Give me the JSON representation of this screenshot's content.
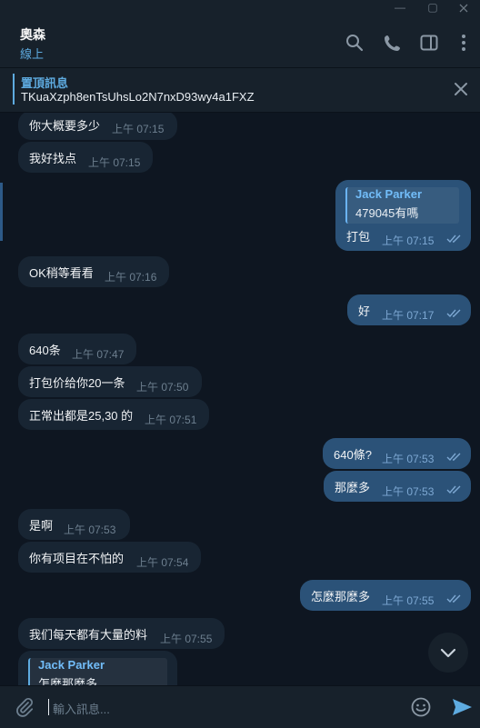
{
  "header": {
    "name": "奧森",
    "status": "線上"
  },
  "window": {
    "minimize": "—",
    "maximize": "▢"
  },
  "pinned": {
    "title": "置頂訊息",
    "text": "TKuaXzph8enTsUhsLo2N7nxD93wy4a1FXZ"
  },
  "messages": [
    {
      "dir": "in",
      "text": "你大概要多少",
      "time": "上午 07:15"
    },
    {
      "dir": "in",
      "text": "我好找点",
      "time": "上午 07:15"
    },
    {
      "dir": "out",
      "reply_name": "Jack Parker",
      "reply_text": "479045有嗎",
      "text": "打包",
      "time": "上午 07:15"
    },
    {
      "dir": "in",
      "text": "OK稍等看看",
      "time": "上午 07:16"
    },
    {
      "dir": "out",
      "text": "好",
      "time": "上午 07:17"
    },
    {
      "dir": "in",
      "text": "640条",
      "time": "上午 07:47"
    },
    {
      "dir": "in",
      "text": "打包价给你20一条",
      "time": "上午 07:50"
    },
    {
      "dir": "in",
      "text": "正常出都是25,30 的",
      "time": "上午 07:51"
    },
    {
      "dir": "out",
      "text": "640條?",
      "time": "上午 07:53"
    },
    {
      "dir": "out",
      "text": "那麼多",
      "time": "上午 07:53"
    },
    {
      "dir": "in",
      "text": "是啊",
      "time": "上午 07:53"
    },
    {
      "dir": "in",
      "text": "你有项目在不怕的",
      "time": "上午 07:54"
    },
    {
      "dir": "out",
      "text": "怎麼那麼多",
      "time": "上午 07:55"
    },
    {
      "dir": "in",
      "text": "我们每天都有大量的料",
      "time": "上午 07:55"
    },
    {
      "dir": "in",
      "reply_name": "Jack Parker",
      "reply_text": "怎麼那麼多"
    }
  ],
  "composer": {
    "placeholder": "輸入訊息..."
  },
  "colors": {
    "background": "#0e1621",
    "incoming_bubble": "#182533",
    "outgoing_bubble": "#2b5278",
    "accent": "#5eabe0"
  },
  "icons": [
    "search-icon",
    "phone-icon",
    "sidebar-toggle-icon",
    "more-vertical-icon",
    "close-icon",
    "chevron-down-icon",
    "attach-icon",
    "emoji-icon",
    "send-icon",
    "double-check-icon"
  ]
}
